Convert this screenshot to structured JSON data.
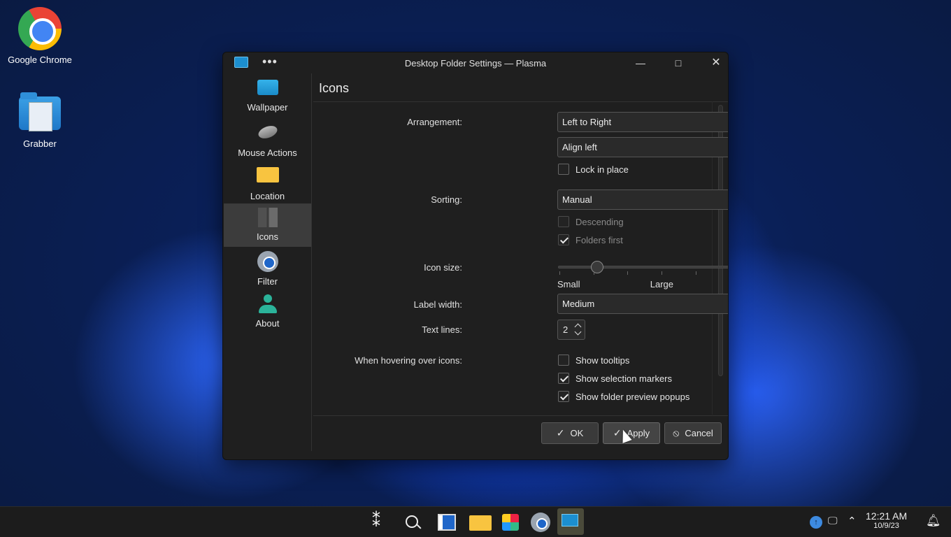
{
  "desktop": {
    "icons": [
      {
        "label": "Google Chrome",
        "icon": "chrome-icon"
      },
      {
        "label": "Grabber",
        "icon": "grabber-folder-icon"
      }
    ]
  },
  "window": {
    "title": "Desktop Folder Settings — Plasma",
    "menu_dots": "•••",
    "min": "—",
    "max": "□",
    "close": "✕"
  },
  "sidebar": {
    "items": [
      {
        "label": "Wallpaper",
        "icon": "wallpaper-icon"
      },
      {
        "label": "Mouse Actions",
        "icon": "mouse-icon"
      },
      {
        "label": "Location",
        "icon": "folder-icon"
      },
      {
        "label": "Icons",
        "icon": "icons-icon",
        "active": true
      },
      {
        "label": "Filter",
        "icon": "filter-icon"
      },
      {
        "label": "About",
        "icon": "about-icon"
      }
    ]
  },
  "page": {
    "title": "Icons",
    "arrangement_label": "Arrangement:",
    "arrangement_value": "Left to Right",
    "align_value": "Align left",
    "lock_label": "Lock in place",
    "lock_checked": false,
    "sorting_label": "Sorting:",
    "sorting_value": "Manual",
    "descending_label": "Descending",
    "descending_checked": false,
    "folders_first_label": "Folders first",
    "folders_first_checked": true,
    "icon_size_label": "Icon size:",
    "icon_size_position_fraction": 0.19,
    "icon_size_min_label": "Small",
    "icon_size_max_label": "Large",
    "label_width_label": "Label width:",
    "label_width_value": "Medium",
    "text_lines_label": "Text lines:",
    "text_lines_value": "2",
    "hover_label": "When hovering over icons:",
    "show_tooltips_label": "Show tooltips",
    "show_tooltips_checked": false,
    "show_selection_label": "Show selection markers",
    "show_selection_checked": true,
    "show_preview_label": "Show folder preview popups",
    "show_preview_checked": true
  },
  "buttons": {
    "ok": "OK",
    "apply": "Apply",
    "cancel": "Cancel"
  },
  "taskbar": {
    "apps": [
      "launcher-icon",
      "search-icon",
      "panel-icon",
      "file-manager-icon",
      "store-icon",
      "settings-icon",
      "plasma-settings-icon"
    ],
    "time": "12:21 AM",
    "date": "10/9/23"
  }
}
